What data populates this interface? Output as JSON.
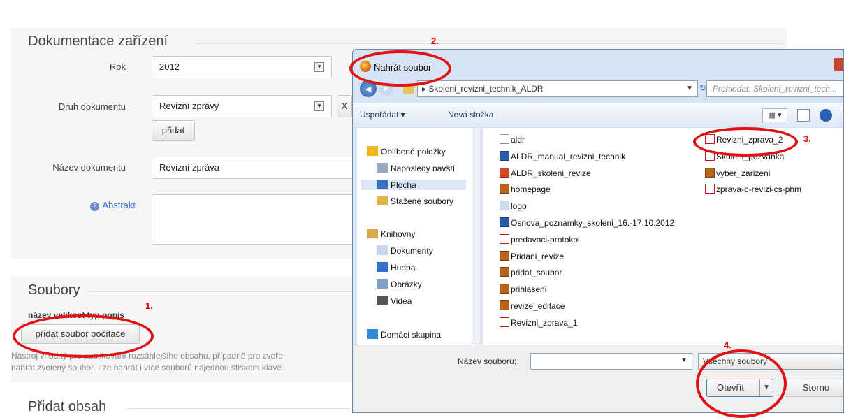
{
  "form": {
    "section1_title": "Dokumentace zařízení",
    "rok_label": "Rok",
    "rok_value": "2012",
    "druh_label": "Druh dokumentu",
    "druh_value": "Revizní zprávy",
    "druh_clear": "X",
    "pridat_label": "přidat",
    "nazev_label": "Název dokumentu",
    "nazev_value": "Revizní zpráva",
    "abstrakt_label": "Abstrakt",
    "section2_title": "Soubory",
    "columns_header": "název velikost typ popis",
    "pridat_soubor_label": "přidat soubor počítače",
    "help_line1": "Nástroj vhodný pro publikování rozsáhlejšího obsahu, případně pro zveře",
    "help_line2": "nahrát zvolený soubor. Lze nahrát i více souborů najednou stiskem kláve",
    "section3_title": "Přidat obsah"
  },
  "annotations": {
    "n1": "1.",
    "n2": "2.",
    "n3": "3.",
    "n4": "4.",
    "color": "#e00000"
  },
  "dialog": {
    "title": "Nahrát soubor",
    "address_path": "Skoleni_revizni_technik_ALDR",
    "search_placeholder": "Prohledat: Skoleni_revizni_tech...",
    "toolbar": {
      "organize": "Uspořádat ▾",
      "new_folder": "Nová složka"
    },
    "nav": [
      {
        "label": "Oblíbené položky",
        "icon": "star-icon"
      },
      {
        "label": "Naposledy navští",
        "icon": "recent-icon"
      },
      {
        "label": "Plocha",
        "icon": "desktop-icon"
      },
      {
        "label": "Stažené soubory",
        "icon": "downloads-icon"
      },
      {
        "label": "Knihovny",
        "icon": "libraries-icon"
      },
      {
        "label": "Dokumenty",
        "icon": "documents-icon"
      },
      {
        "label": "Hudba",
        "icon": "music-icon"
      },
      {
        "label": "Obrázky",
        "icon": "pictures-icon"
      },
      {
        "label": "Videa",
        "icon": "video-icon"
      },
      {
        "label": "Domácí skupina",
        "icon": "homegroup-icon"
      }
    ],
    "files_col1": [
      {
        "name": "aldr",
        "type": "file"
      },
      {
        "name": "ALDR_manual_revizni_technik",
        "type": "word"
      },
      {
        "name": "ALDR_skoleni_revize",
        "type": "ppt"
      },
      {
        "name": "homepage",
        "type": "image"
      },
      {
        "name": "logo",
        "type": "image2"
      },
      {
        "name": "Osnova_poznamky_skoleni_16.-17.10.2012",
        "type": "word"
      },
      {
        "name": "predavaci-protokol",
        "type": "pdf"
      },
      {
        "name": "Pridani_revize",
        "type": "image"
      },
      {
        "name": "pridat_soubor",
        "type": "image"
      },
      {
        "name": "prihlaseni",
        "type": "image"
      },
      {
        "name": "revize_editace",
        "type": "image"
      },
      {
        "name": "Revizni_zprava_1",
        "type": "pdf"
      }
    ],
    "files_col2": [
      {
        "name": "Revizni_zprava_2",
        "type": "pdf"
      },
      {
        "name": "Skoleni_pozvanka",
        "type": "pdf"
      },
      {
        "name": "vyber_zarizeni",
        "type": "image"
      },
      {
        "name": "zprava-o-revizi-cs-phm",
        "type": "pdf"
      }
    ],
    "filename_label": "Název souboru:",
    "filter_value": "Všechny soubory",
    "open_label": "Otevřít",
    "cancel_label": "Storno"
  }
}
